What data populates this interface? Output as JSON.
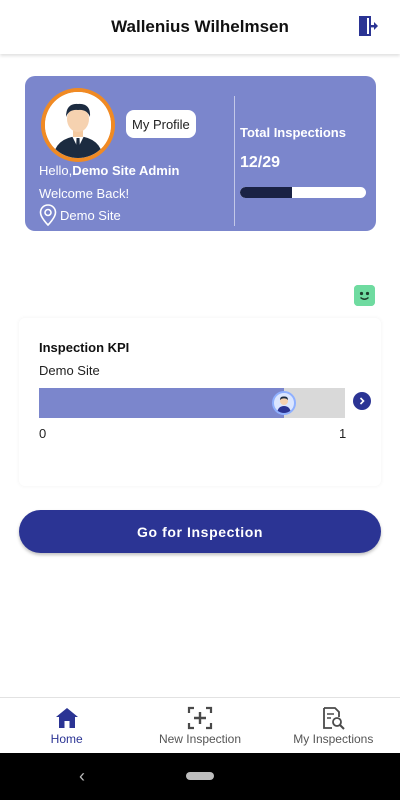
{
  "header": {
    "title": "Wallenius Wilhelmsen"
  },
  "profile": {
    "my_profile_label": "My Profile",
    "greeting_prefix": "Hello,",
    "user_name": "Demo Site Admin",
    "welcome": "Welcome Back!",
    "site": "Demo Site",
    "total_label": "Total Inspections",
    "total_count": "12/29",
    "total_progress": 0.41,
    "avatar_ring_color": "#f08a24"
  },
  "kpi": {
    "title": "Inspection KPI",
    "site": "Demo Site",
    "min_label": "0",
    "max_label": "1",
    "progress": 0.8
  },
  "actions": {
    "go_label": "Go for Inspection"
  },
  "bottom_nav": [
    {
      "label": "Home",
      "icon": "home-icon",
      "active": true
    },
    {
      "label": "New Inspection",
      "icon": "add-scan-icon",
      "active": false
    },
    {
      "label": "My Inspections",
      "icon": "document-search-icon",
      "active": false
    }
  ],
  "system_nav": {
    "back_glyph": "‹"
  },
  "colors": {
    "card": "#7b86cc",
    "primary": "#2b3494",
    "bar_dark": "#1a2244",
    "emoji_green": "#6fdba0"
  }
}
